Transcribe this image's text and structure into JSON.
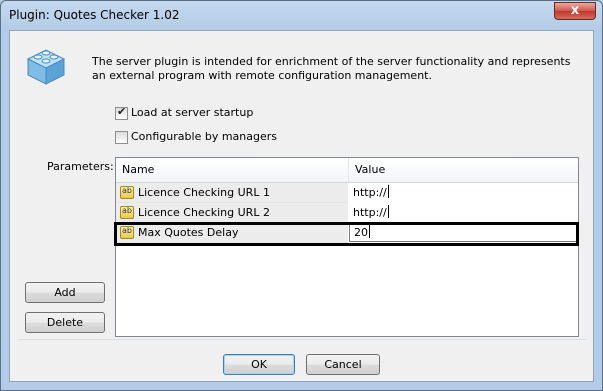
{
  "window": {
    "title": "Plugin: Quotes Checker 1.02",
    "close_glyph": "x"
  },
  "description": "The server plugin is intended for enrichment of the server functionality and represents an external program with remote configuration management.",
  "icon": "plugin-blocks-icon",
  "options": {
    "load_at_startup": {
      "label": "Load at server startup",
      "checked": true
    },
    "configurable_by_managers": {
      "label": "Configurable by managers",
      "checked": false
    }
  },
  "parameters": {
    "label": "Parameters:",
    "columns": {
      "name": "Name",
      "value": "Value"
    },
    "rows": [
      {
        "icon_text": "ab",
        "name": "Licence Checking URL 1",
        "value": "http://"
      },
      {
        "icon_text": "ab",
        "name": "Licence Checking URL 2",
        "value": "http://"
      },
      {
        "icon_text": "ab",
        "name": "Max Quotes Delay",
        "value": "20"
      }
    ]
  },
  "buttons": {
    "add": "Add",
    "delete": "Delete",
    "ok": "OK",
    "cancel": "Cancel"
  },
  "colors": {
    "frame": "#b9d1ea",
    "client": "#f0f0f0",
    "close_button": "#c0392b"
  }
}
